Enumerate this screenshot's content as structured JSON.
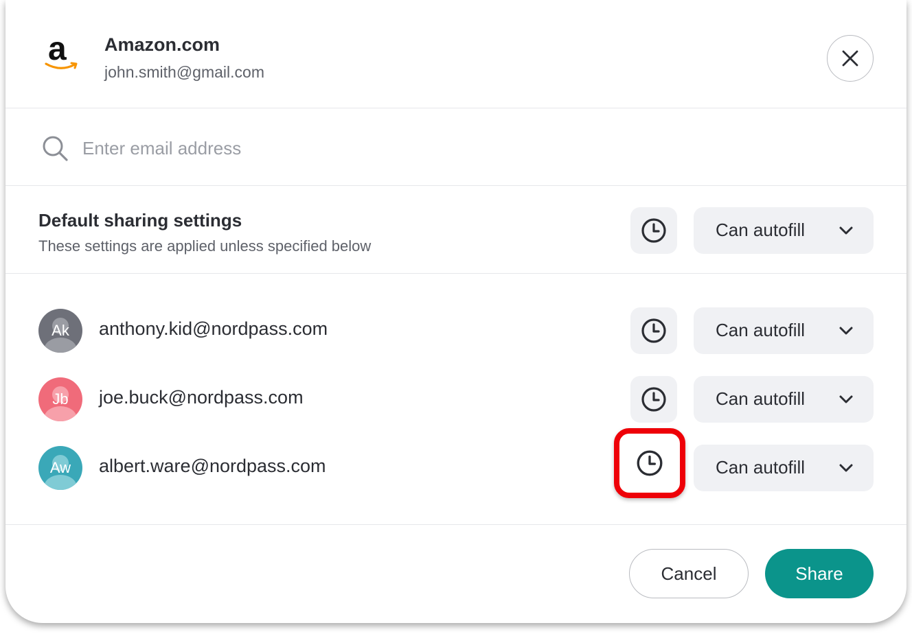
{
  "header": {
    "site_name": "Amazon.com",
    "account_email": "john.smith@gmail.com",
    "logo_letter": "a"
  },
  "search": {
    "placeholder": "Enter email address",
    "value": ""
  },
  "default_settings": {
    "title": "Default sharing settings",
    "subtitle": "These settings are applied unless specified below",
    "permission": "Can autofill"
  },
  "users": [
    {
      "initials": "Ak",
      "email": "anthony.kid@nordpass.com",
      "permission": "Can autofill",
      "avatar_color": "#6e7079"
    },
    {
      "initials": "Jb",
      "email": "joe.buck@nordpass.com",
      "permission": "Can autofill",
      "avatar_color": "#f06b7a"
    },
    {
      "initials": "Aw",
      "email": "albert.ware@nordpass.com",
      "permission": "Can autofill",
      "avatar_color": "#3aa8b8"
    }
  ],
  "footer": {
    "cancel_label": "Cancel",
    "share_label": "Share"
  },
  "colors": {
    "accent": "#0b948b",
    "highlight": "#ee0008",
    "control_bg": "#f0f1f4"
  },
  "icons": {
    "close": "close-icon",
    "search": "search-icon",
    "clock": "clock-icon",
    "chevron": "chevron-down-icon"
  }
}
